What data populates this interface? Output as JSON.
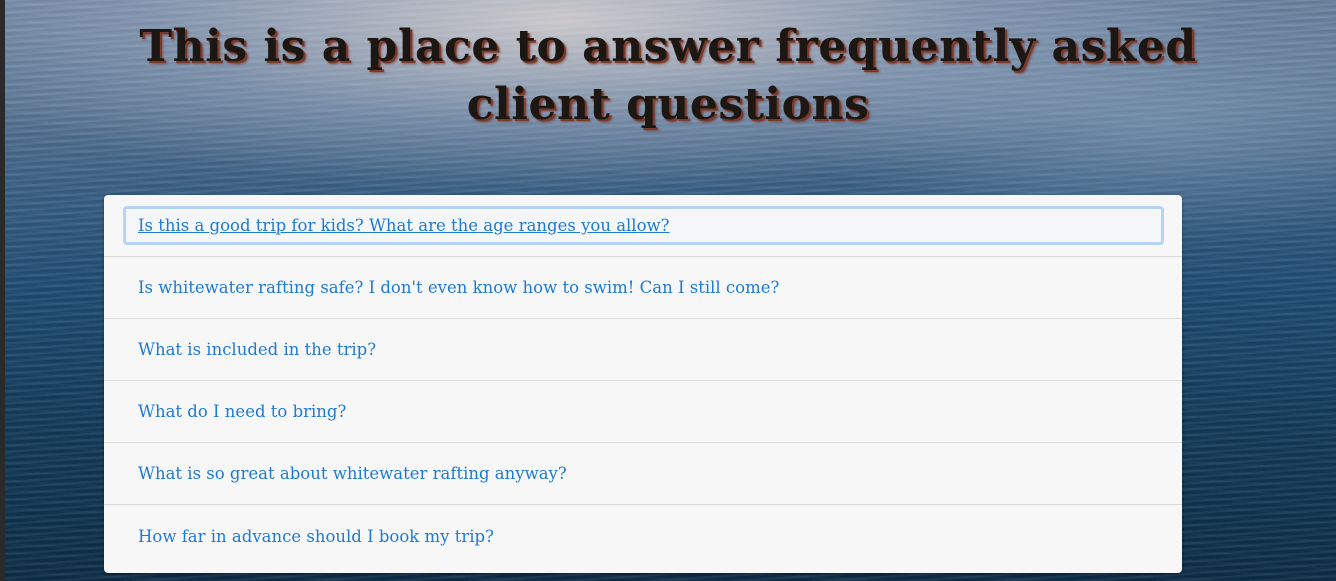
{
  "page": {
    "heading": "This is a place to answer frequently asked client questions"
  },
  "faq": {
    "items": [
      {
        "question": "Is this a good trip for kids? What are the age ranges you allow?",
        "focused": true
      },
      {
        "question": "Is whitewater rafting safe? I don't even know how to swim! Can I still come?"
      },
      {
        "question": "What is included in the trip?"
      },
      {
        "question": "What do I need to bring?"
      },
      {
        "question": "What is so great about whitewater rafting anyway?"
      },
      {
        "question": "How far in advance should I book my trip?"
      }
    ]
  },
  "colors": {
    "link": "#1f7ad6",
    "panel": "#f7f7f7",
    "heading": "#1d1714",
    "focus_ring": "#b7d4f5"
  }
}
